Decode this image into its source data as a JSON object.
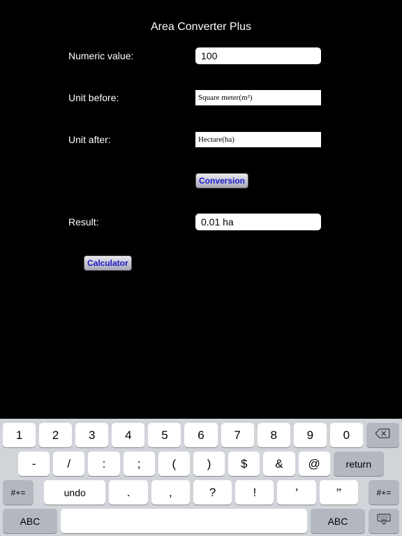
{
  "title": "Area Converter Plus",
  "fields": {
    "numeric_value": {
      "label": "Numeric value:",
      "value": "100"
    },
    "unit_before": {
      "label": "Unit before:",
      "value": "Square meter(m²)"
    },
    "unit_after": {
      "label": "Unit after:",
      "value": "Hectare(ha)"
    },
    "result": {
      "label": "Result:",
      "value": "0.01 ha"
    }
  },
  "buttons": {
    "conversion": "Conversion",
    "calculator": "Calculator"
  },
  "keyboard": {
    "row1": [
      "1",
      "2",
      "3",
      "4",
      "5",
      "6",
      "7",
      "8",
      "9",
      "0"
    ],
    "row2": [
      "-",
      "/",
      ":",
      ";",
      "(",
      ")",
      "$",
      "&",
      "@"
    ],
    "return": "return",
    "row3_side": "#+=",
    "undo": "undo",
    "row3_mid": [
      ".",
      ",",
      "?",
      "!",
      "’",
      "”"
    ],
    "abc": "ABC"
  }
}
